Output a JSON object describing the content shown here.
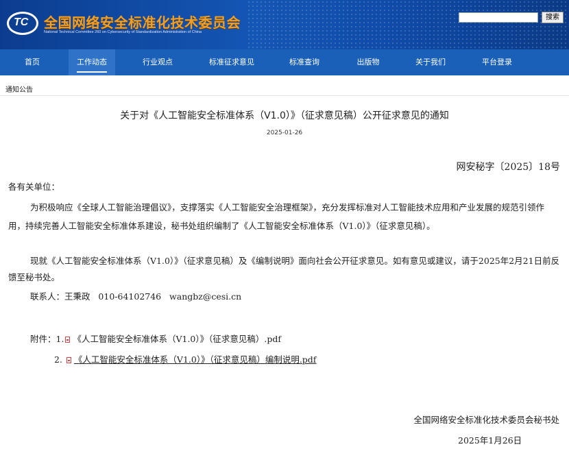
{
  "header": {
    "logo_text": "TC",
    "site_title": "全国网络安全标准化技术委员会",
    "site_subtitle": "National Technical Committee 260 on Cybersecurity of Standardization Administration of China",
    "search": {
      "placeholder": "",
      "button_label": "搜索"
    }
  },
  "nav": {
    "items": [
      {
        "label": "首页"
      },
      {
        "label": "工作动态",
        "active": true
      },
      {
        "label": "行业观点"
      },
      {
        "label": "标准征求意见"
      },
      {
        "label": "标准查询"
      },
      {
        "label": "出版物"
      },
      {
        "label": "关于我们"
      },
      {
        "label": "平台登录"
      }
    ]
  },
  "breadcrumb": "通知公告",
  "article": {
    "title": "关于对《人工智能安全标准体系（V1.0）》（征求意见稿）公开征求意见的通知",
    "date": "2025-01-26",
    "doc_number": "网安秘字〔2025〕18号",
    "greeting": "各有关单位：",
    "paragraphs": [
      "为积极响应《全球人工智能治理倡议》，支撑落实《人工智能安全治理框架》，充分发挥标准对人工智能技术应用和产业发展的规范引领作用，持续完善人工智能安全标准体系建设，秘书处组织编制了《人工智能安全标准体系（V1.0）》（征求意见稿）。",
      "现就《人工智能安全标准体系（V1.0）》（征求意见稿）及《编制说明》面向社会公开征求意见。如有意见或建议，请于2025年2月21日前反馈至秘书处。"
    ],
    "contact": "联系人：王秉政   010-64102746   wangbz@cesi.cn",
    "attachments": {
      "label": "附件：",
      "items": [
        {
          "num": "1.",
          "name": "《人工智能安全标准体系（V1.0）》（征求意见稿）.pdf"
        },
        {
          "num": "2.",
          "name": "《人工智能安全标准体系（V1.0）》（征求意见稿）编制说明.pdf"
        }
      ]
    },
    "signature_org": "全国网络安全标准化技术委员会秘书处",
    "signature_date": "2025年1月26日"
  },
  "colors": {
    "header_bg": "#1456b5",
    "nav_bg": "#1a5fb8",
    "title_orange": "#f0a028"
  },
  "icons": {
    "attachment": "pdf-icon"
  }
}
